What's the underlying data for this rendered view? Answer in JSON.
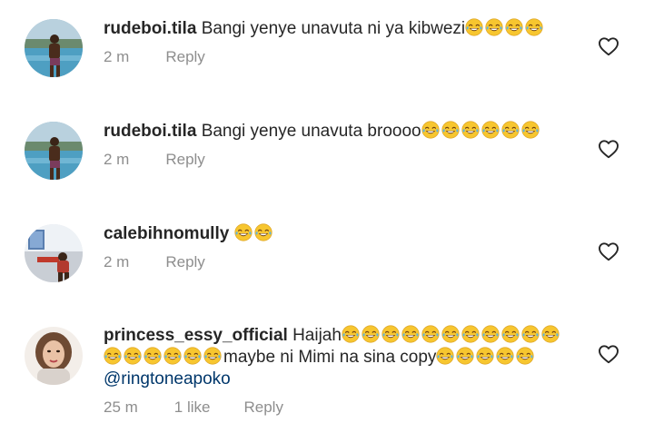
{
  "comments": [
    {
      "username": "rudeboi.tila",
      "text": "Bangi yenye unavuta ni ya kibwezi",
      "emoji_count": 4,
      "time": "2 m",
      "reply_label": "Reply"
    },
    {
      "username": "rudeboi.tila",
      "text": "Bangi yenye unavuta broooo",
      "emoji_count": 6,
      "time": "2 m",
      "reply_label": "Reply"
    },
    {
      "username": "calebihnomully",
      "text": "",
      "emoji_count": 2,
      "time": "2 m",
      "reply_label": "Reply"
    },
    {
      "username": "princess_essy_official",
      "text_part1": "Haijah",
      "emoji_count_1": 11,
      "emoji_count_2": 6,
      "text_part2": "maybe ni Mimi na sina copy",
      "emoji_count_3": 5,
      "mention": "@ringtoneapoko",
      "time": "25 m",
      "likes": "1 like",
      "reply_label": "Reply"
    }
  ],
  "icons": {
    "emoji": "face-with-tears-of-joy-icon",
    "like": "heart-outline-icon"
  },
  "colors": {
    "text": "#262626",
    "meta": "#8e8e8e",
    "mention": "#00376b",
    "emoji_face": "#f7c62f",
    "emoji_tears": "#5ab4e8"
  }
}
